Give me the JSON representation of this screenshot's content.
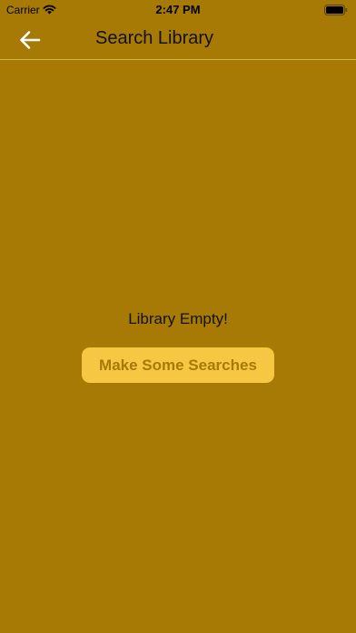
{
  "status_bar": {
    "carrier": "Carrier",
    "time": "2:47 PM",
    "wifi_icon": "wifi-icon",
    "battery_icon": "battery-icon"
  },
  "nav": {
    "back_icon": "back-arrow-icon",
    "title": "Search Library"
  },
  "empty_state": {
    "message": "Library Empty!",
    "button_label": "Make Some Searches"
  },
  "colors": {
    "background": "#A67A05",
    "button_background": "#F6C743",
    "button_text": "#A67A05",
    "divider": "#D3B446"
  }
}
